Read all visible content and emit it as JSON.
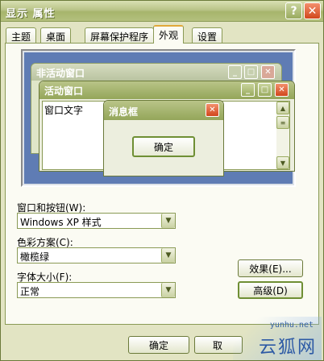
{
  "window": {
    "title": "显示 属性"
  },
  "tabs": [
    "主题",
    "桌面",
    "屏幕保护程序",
    "外观",
    "设置"
  ],
  "preview": {
    "inactive_title": "非活动窗口",
    "active_title": "活动窗口",
    "window_text": "窗口文字",
    "msgbox_title": "消息框",
    "msgbox_ok": "确定"
  },
  "form": {
    "style_label": "窗口和按钮(W):",
    "style_value": "Windows XP 样式",
    "scheme_label": "色彩方案(C):",
    "scheme_value": "橄榄绿",
    "fontsize_label": "字体大小(F):",
    "fontsize_value": "正常",
    "effects_button": "效果(E)...",
    "advanced_button": "高级(D)"
  },
  "footer": {
    "ok": "确定",
    "cancel_partial": "取"
  },
  "watermark": {
    "url": "yunhu.net",
    "text": "云狐网"
  }
}
